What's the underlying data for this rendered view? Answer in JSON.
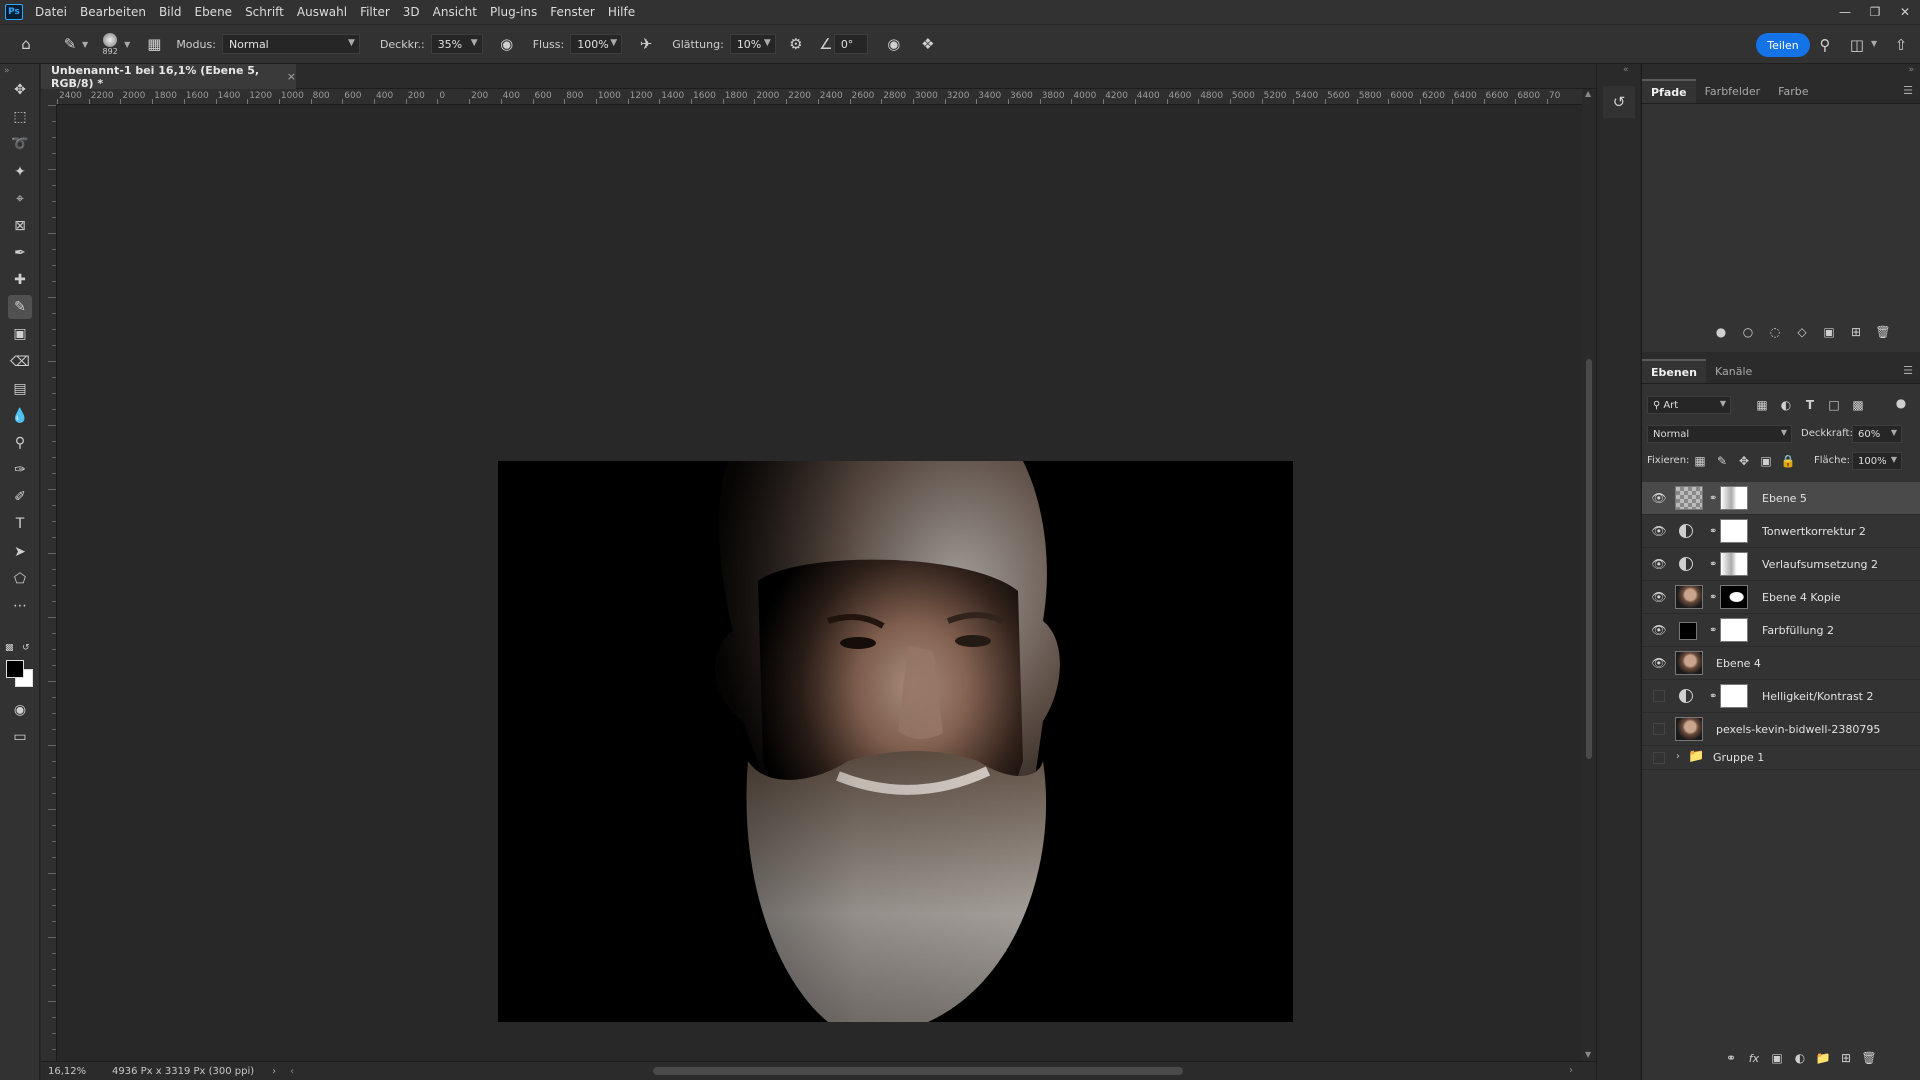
{
  "app": {
    "logo": "Ps"
  },
  "menu": [
    "Datei",
    "Bearbeiten",
    "Bild",
    "Ebene",
    "Schrift",
    "Auswahl",
    "Filter",
    "3D",
    "Ansicht",
    "Plug-ins",
    "Fenster",
    "Hilfe"
  ],
  "options": {
    "brush_size": "892",
    "mode_label": "Modus:",
    "mode_value": "Normal",
    "opacity_label": "Deckkr.:",
    "opacity_value": "35%",
    "flow_label": "Fluss:",
    "flow_value": "100%",
    "smoothing_label": "Glättung:",
    "smoothing_value": "10%",
    "angle_value": "0°",
    "share_label": "Teilen"
  },
  "document": {
    "tab_title": "Unbenannt-1 bei 16,1% (Ebene 5, RGB/8) *",
    "close_glyph": "×",
    "zoom": "16,12%",
    "dimensions": "4936 Px x 3319 Px (300 ppi)"
  },
  "ruler_h_labels": [
    "2400",
    "2200",
    "2000",
    "1800",
    "1600",
    "1400",
    "1200",
    "1000",
    "800",
    "600",
    "400",
    "200",
    "0",
    "200",
    "400",
    "600",
    "800",
    "1000",
    "1200",
    "1400",
    "1600",
    "1800",
    "2000",
    "2200",
    "2400",
    "2600",
    "2800",
    "3000",
    "3200",
    "3400",
    "3600",
    "3800",
    "4000",
    "4200",
    "4400",
    "4600",
    "4800",
    "5000",
    "5200",
    "5400",
    "5600",
    "5800",
    "6000",
    "6200",
    "6400",
    "6600",
    "6800",
    "70"
  ],
  "panels_top": {
    "tabs": [
      "Pfade",
      "Farbfelder",
      "Farbe"
    ],
    "active_tab": "Pfade"
  },
  "layers_panel": {
    "tabs": [
      "Ebenen",
      "Kanäle"
    ],
    "filter_label": "Art",
    "blend_mode": "Normal",
    "opacity_label": "Deckkraft:",
    "opacity_value": "60%",
    "lock_label": "Fixieren:",
    "fill_label": "Fläche:",
    "fill_value": "100%",
    "layers": [
      {
        "name": "Ebene 5",
        "visible": true,
        "selected": true
      },
      {
        "name": "Tonwertkorrektur 2",
        "visible": true,
        "selected": false
      },
      {
        "name": "Verlaufsumsetzung 2",
        "visible": true,
        "selected": false
      },
      {
        "name": "Ebene 4 Kopie",
        "visible": true,
        "selected": false
      },
      {
        "name": "Farbfüllung 2",
        "visible": true,
        "selected": false
      },
      {
        "name": "Ebene 4",
        "visible": true,
        "selected": false
      },
      {
        "name": "Helligkeit/Kontrast 2",
        "visible": false,
        "selected": false
      },
      {
        "name": "pexels-kevin-bidwell-2380795",
        "visible": false,
        "selected": false
      },
      {
        "name": "Gruppe 1",
        "visible": false,
        "selected": false
      }
    ]
  }
}
